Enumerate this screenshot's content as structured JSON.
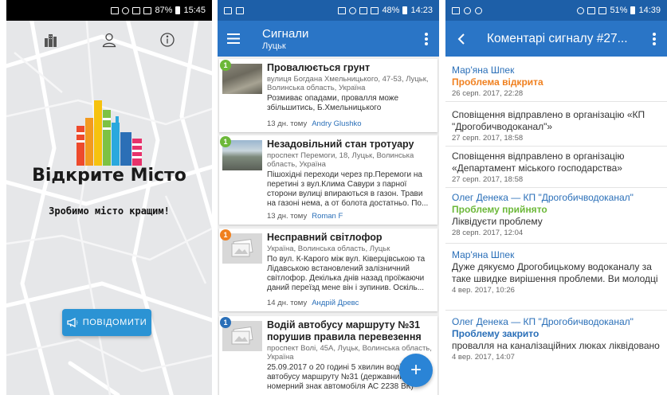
{
  "colors": {
    "primary": "#2a75c6",
    "status_bar": "#1d5fa8",
    "accent_button": "#2b93d4",
    "status_open": "#f0801f",
    "status_accepted": "#6cb839",
    "status_closed": "#2a6fb8",
    "author_link": "#2a6fb8"
  },
  "screen1": {
    "statusbar": {
      "battery": "87%",
      "time": "15:45"
    },
    "top_icons": [
      "city-icon",
      "user-icon",
      "info-icon"
    ],
    "app_name": "Відкрите Місто",
    "slogan": "Зробимо місто кращим!",
    "report_button": {
      "icon": "megaphone-icon",
      "label": "ПОВІДОМИТИ"
    }
  },
  "screen2": {
    "statusbar": {
      "battery": "48%",
      "time": "14:23"
    },
    "appbar": {
      "title": "Сигнали",
      "subtitle": "Луцьк"
    },
    "signals": [
      {
        "badge": "1",
        "badge_color": "#6cb839",
        "thumb": "photo1",
        "title": "Провалюється грунт",
        "address": "вулиця Богдана Хмельницького, 47-53, Луцьк, Волинська область, Україна",
        "description": "Розмиває опадами, провалля може збільшитись, Б.Хмельницького",
        "age": "13 дн. тому",
        "author": "Andry Glushko"
      },
      {
        "badge": "1",
        "badge_color": "#6cb839",
        "thumb": "photo2",
        "title": "Незадовільний стан тротуару",
        "address": "проспект Перемоги, 18, Луцьк, Волинська область, Україна",
        "description": "Пішохідні переходи через пр.Перемоги на перетині з вул.Клима Савури з парної сторони вулиці впираються в газон. Трави на газоні нема, а от болота достатньо. По...",
        "age": "13 дн. тому",
        "author": "Roman F"
      },
      {
        "badge": "1",
        "badge_color": "#f0801f",
        "thumb": "placeholder",
        "title": "Несправний світлофор",
        "address": "Україна, Волинська область, Луцьк",
        "description": "По вул. К-Карого між вул. Ківерцівською та Лідавською встановлений залізничний світлофор. Декілька днів назад проїжаючи даний переїзд мене він і зупинив. Оскіль...",
        "age": "14 дн. тому",
        "author": "Андрій Древс"
      },
      {
        "badge": "1",
        "badge_color": "#2a6fb8",
        "thumb": "placeholder",
        "title": "Водій автобусу маршруту №31 порушив правила перевезення",
        "address": "проспект Волі, 45А, Луцьк, Волинська область, Україна",
        "description": "25.09.2017 о 20 годині 5 хвилин водій автобусу маршруту №31 (державний номерний знак автомобіля АС 2238 ВК)",
        "age": "",
        "author": ""
      }
    ],
    "fab_label": "+"
  },
  "screen3": {
    "statusbar": {
      "battery": "51%",
      "time": "14:39"
    },
    "appbar": {
      "title": "Коментарі сигналу #27..."
    },
    "comments": [
      {
        "author": "Мар'яна Шпек",
        "status": "Проблема відкрита",
        "status_color": "#f0801f",
        "text": "",
        "date": "26 серп. 2017, 22:28"
      },
      {
        "author": "",
        "status": "",
        "status_color": "",
        "text": "Сповіщення відправлено в організацію «КП \"Дрогобичводоканал\"»",
        "date": "27 серп. 2017, 18:58"
      },
      {
        "author": "",
        "status": "",
        "status_color": "",
        "text": "Сповіщення відправлено в організацію «Департамент міського господарства»",
        "date": "27 серп. 2017, 18:58"
      },
      {
        "author": "Олег Денека — КП \"Дрогобичводоканал\"",
        "status": "Проблему прийнято",
        "status_color": "#6cb839",
        "text": "Ліквідуєти проблему",
        "date": "28 серп. 2017, 12:04"
      },
      {
        "author": "Мар'яна Шпек",
        "status": "",
        "status_color": "",
        "text": "Дуже дякуємо Дрогобицькому водоканалу за таке швидке вирішення проблеми. Ви молодці",
        "date": "4 вер. 2017, 10:26"
      },
      {
        "author": "Олег Денека — КП \"Дрогобичводоканал\"",
        "status": "Проблему закрито",
        "status_color": "#2a6fb8",
        "text": "провалля на каналізаційних люках ліквідовано",
        "date": "4 вер. 2017, 14:07"
      }
    ]
  }
}
